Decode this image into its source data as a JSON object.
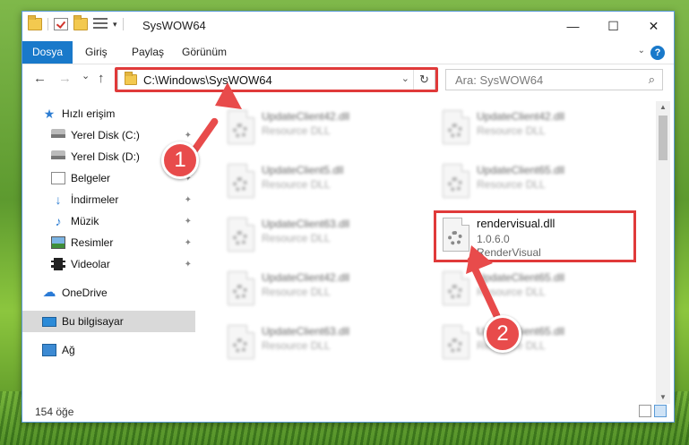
{
  "window": {
    "title": "SysWOW64",
    "controls": {
      "minimize": "—",
      "maximize": "☐",
      "close": "✕"
    }
  },
  "ribbon": {
    "tabs": [
      "Dosya",
      "Giriş",
      "Paylaş",
      "Görünüm"
    ],
    "help": "?"
  },
  "navbar": {
    "back": "←",
    "forward": "→",
    "recent": "⌄",
    "up": "↑",
    "address": "C:\\Windows\\SysWOW64",
    "refresh": "↻",
    "search_placeholder": "Ara: SysWOW64",
    "search_icon": "⌕"
  },
  "sidebar": {
    "items": [
      {
        "label": "Hızlı erişim",
        "icon": "star-icon",
        "pinned": false
      },
      {
        "label": "Yerel Disk (C:)",
        "icon": "disk-icon",
        "pinned": true
      },
      {
        "label": "Yerel Disk (D:)",
        "icon": "disk-icon",
        "pinned": true
      },
      {
        "label": "Belgeler",
        "icon": "documents-icon",
        "pinned": true
      },
      {
        "label": "İndirmeler",
        "icon": "download-icon",
        "pinned": true
      },
      {
        "label": "Müzik",
        "icon": "music-icon",
        "pinned": true
      },
      {
        "label": "Resimler",
        "icon": "pictures-icon",
        "pinned": true
      },
      {
        "label": "Videolar",
        "icon": "videos-icon",
        "pinned": true
      },
      {
        "label": "OneDrive",
        "icon": "cloud-icon",
        "pinned": false
      },
      {
        "label": "Bu bilgisayar",
        "icon": "computer-icon",
        "pinned": false,
        "selected": true
      },
      {
        "label": "Ağ",
        "icon": "network-icon",
        "pinned": false
      }
    ],
    "pin_glyph": "📌"
  },
  "files": {
    "blurred": [
      {
        "name": "UpdateClient42.dll",
        "type": "Resource DLL"
      },
      {
        "name": "UpdateClient42.dll",
        "type": "Resource DLL"
      },
      {
        "name": "UpdateClient5.dll",
        "type": "Resource DLL"
      },
      {
        "name": "UpdateClient65.dll",
        "type": "Resource DLL"
      },
      {
        "name": "UpdateClient63.dll",
        "type": "Resource DLL"
      },
      {
        "name": "UpdateClient42.dll",
        "type": "Resource DLL"
      },
      {
        "name": "UpdateClient65.dll",
        "type": "Resource DLL"
      },
      {
        "name": "UpdateClient63.dll",
        "type": "Resource DLL"
      },
      {
        "name": "UpdateClient65.dll",
        "type": "Resource DLL"
      }
    ],
    "highlighted": {
      "name": "rendervisual.dll",
      "version": "1.0.6.0",
      "description": "RenderVisual"
    }
  },
  "status": {
    "count": "154 öğe"
  },
  "annotations": {
    "step1": "1",
    "step2": "2",
    "color": "#e84b4b"
  }
}
